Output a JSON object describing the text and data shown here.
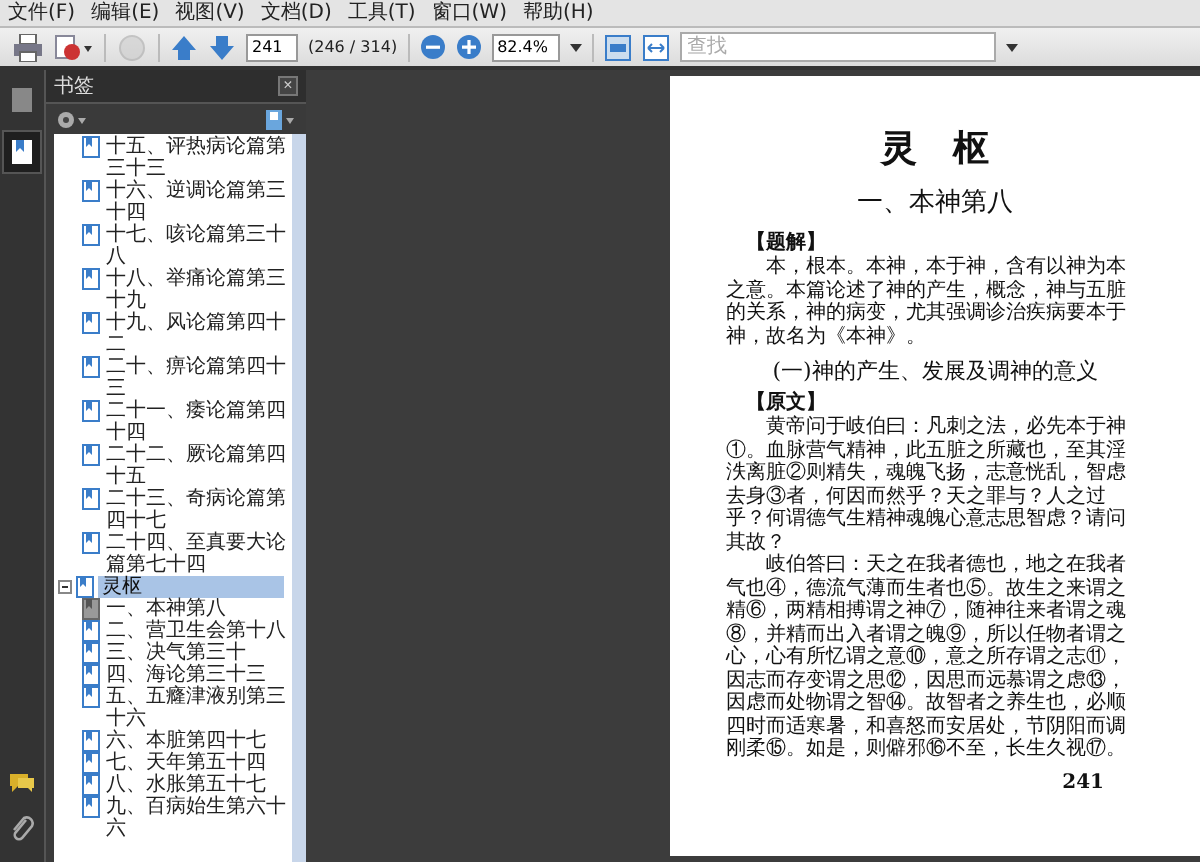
{
  "menu": [
    "文件(F)",
    "编辑(E)",
    "视图(V)",
    "文档(D)",
    "工具(T)",
    "窗口(W)",
    "帮助(H)"
  ],
  "toolbar": {
    "page_field": "241",
    "page_count": "(246 / 314)",
    "zoom_field": "82.4%",
    "search": {
      "placeholder": "查找"
    }
  },
  "side_tabs": [
    {
      "kind": "pages",
      "selected": false
    },
    {
      "kind": "bookmarks",
      "selected": true
    }
  ],
  "bookmarks": {
    "title": "书签",
    "close": "×",
    "tree": [
      {
        "children": [
          {
            "label": "十五、评热病论篇第三十三",
            "current": false
          },
          {
            "label": "十六、逆调论篇第三十四",
            "current": false
          },
          {
            "label": "十七、咳论篇第三十八",
            "current": false
          },
          {
            "label": "十八、举痛论篇第三十九",
            "current": false
          },
          {
            "label": "十九、风论篇第四十二",
            "current": false
          },
          {
            "label": "二十、痹论篇第四十三",
            "current": false
          },
          {
            "label": "二十一、痿论篇第四十四",
            "current": false
          },
          {
            "label": "二十二、厥论篇第四十五",
            "current": false
          },
          {
            "label": "二十三、奇病论篇第四十七",
            "current": false
          },
          {
            "label": "二十四、至真要大论篇第七十四",
            "current": false
          }
        ]
      },
      {
        "label": "灵枢",
        "expanded": true,
        "selected": true,
        "children": [
          {
            "label": "一、本神第八",
            "current": true
          },
          {
            "label": "二、营卫生会第十八",
            "current": false
          },
          {
            "label": "三、决气第三十",
            "current": false
          },
          {
            "label": "四、海论第三十三",
            "current": false
          },
          {
            "label": "五、五癃津液别第三十六",
            "current": false
          },
          {
            "label": "六、本脏第四十七",
            "current": false
          },
          {
            "label": "七、天年第五十四",
            "current": false
          },
          {
            "label": "八、水胀第五十七",
            "current": false
          },
          {
            "label": "九、百病始生第六十六",
            "current": false
          }
        ]
      }
    ]
  },
  "page": {
    "title": "灵　枢",
    "chapter": "一、本神第八",
    "blocks": [
      {
        "kind": "label",
        "text": "【题解】"
      },
      {
        "kind": "para",
        "text": "本，根本。本神，本于神，含有以神为本之意。本篇论述了神的产生，概念，神与五脏的关系，神的病变，尤其强调诊治疾病要本于神，故名为《本神》。"
      },
      {
        "kind": "heading",
        "text": "(一)神的产生、发展及调神的意义"
      },
      {
        "kind": "label",
        "text": "【原文】"
      },
      {
        "kind": "para",
        "text": "黄帝问于岐伯曰：凡刺之法，必先本于神①。血脉营气精神，此五脏之所藏也，至其淫泆离脏②则精失，魂魄飞扬，志意恍乱，智虑去身③者，何因而然乎？天之罪与？人之过乎？何谓德气生精神魂魄心意志思智虑？请问其故？"
      },
      {
        "kind": "para",
        "text": "岐伯答曰：天之在我者德也，地之在我者气也④，德流气薄而生者也⑤。故生之来谓之精⑥，两精相搏谓之神⑦，随神往来者谓之魂⑧，并精而出入者谓之魄⑨，所以任物者谓之心，心有所忆谓之意⑩，意之所存谓之志⑪，因志而存变谓之思⑫，因思而远慕谓之虑⑬，因虑而处物谓之智⑭。故智者之养生也，必顺四时而适寒暑，和喜怒而安居处，节阴阳而调刚柔⑮。如是，则僻邪⑯不至，长生久视⑰。"
      }
    ],
    "page_number": "241"
  }
}
